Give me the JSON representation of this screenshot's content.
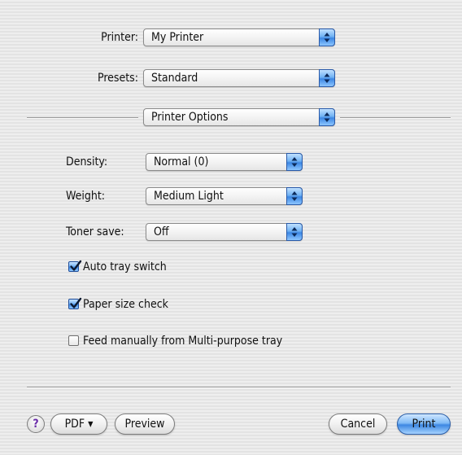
{
  "printer": {
    "label": "Printer:",
    "value": "My Printer"
  },
  "presets": {
    "label": "Presets:",
    "value": "Standard"
  },
  "pane": {
    "value": "Printer Options"
  },
  "options": {
    "density": {
      "label": "Density:",
      "value": "Normal (0)"
    },
    "weight": {
      "label": "Weight:",
      "value": "Medium Light"
    },
    "toner_save": {
      "label": "Toner save:",
      "value": "Off"
    }
  },
  "checkboxes": {
    "auto_tray": {
      "label": "Auto tray switch",
      "checked": true
    },
    "paper_size": {
      "label": "Paper size check",
      "checked": true
    },
    "feed_manual": {
      "label": "Feed manually from Multi-purpose tray",
      "checked": false
    }
  },
  "buttons": {
    "help": "?",
    "pdf": "PDF ▾",
    "preview": "Preview",
    "cancel": "Cancel",
    "print": "Print"
  },
  "icons": {
    "popup_arrows": "up-down-arrows-icon",
    "checkmark": "checkmark-icon"
  },
  "colors": {
    "aqua_blue": "#3d88e3",
    "background": "#ececec",
    "help_glyph": "#6a2ca8"
  }
}
